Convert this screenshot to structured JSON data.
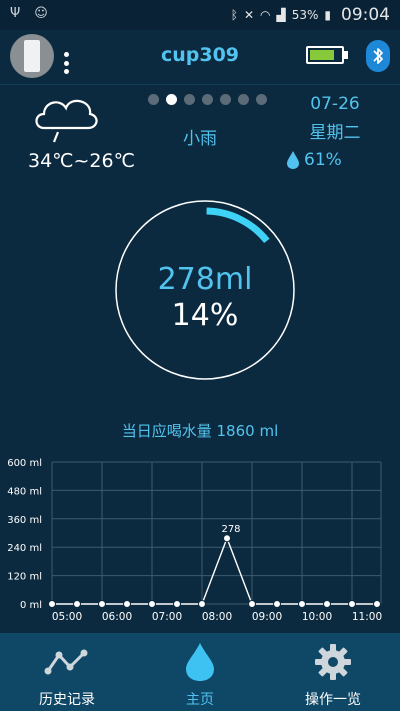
{
  "status_bar": {
    "battery_percent": "53%",
    "time": "09:04"
  },
  "header": {
    "title": "cup309",
    "battery_level": 0.8
  },
  "weather": {
    "temperature_range": "34℃~26℃",
    "description": "小雨",
    "date": "07-26",
    "weekday": "星期二",
    "humidity": "61%",
    "page_count": 7,
    "active_page": 1
  },
  "intake": {
    "amount": "278ml",
    "percent": "14%",
    "progress": 0.14,
    "daily_target_text": "当日应喝水量 1860 ml"
  },
  "colors": {
    "accent": "#52c3ee",
    "background": "#0c2a3f",
    "nav_background": "#0f4766",
    "battery_fill": "#86c93a"
  },
  "chart_data": {
    "type": "line",
    "x": [
      "05:00",
      "05:30",
      "06:00",
      "06:30",
      "07:00",
      "07:30",
      "08:00",
      "08:30",
      "09:00",
      "09:30",
      "10:00",
      "10:30",
      "11:00",
      "11:30"
    ],
    "x_tick_labels": [
      "05:00",
      "06:00",
      "07:00",
      "08:00",
      "09:00",
      "10:00",
      "11:00"
    ],
    "values": [
      0,
      0,
      0,
      0,
      0,
      0,
      0,
      278,
      0,
      0,
      0,
      0,
      0,
      0
    ],
    "y_tick_labels": [
      "0 ml",
      "120 ml",
      "240 ml",
      "360 ml",
      "480 ml",
      "600 ml"
    ],
    "point_labels": [
      {
        "index": 7,
        "text": "278"
      }
    ],
    "ylim": [
      0,
      600
    ],
    "grid": true
  },
  "nav": {
    "items": [
      {
        "label": "历史记录",
        "icon": "history-chart-icon"
      },
      {
        "label": "主页",
        "icon": "water-drop-icon"
      },
      {
        "label": "操作一览",
        "icon": "gear-icon"
      }
    ],
    "active_index": 1
  }
}
